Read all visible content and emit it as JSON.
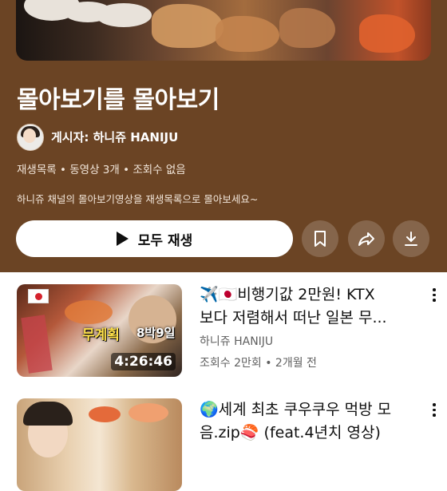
{
  "playlist": {
    "title": "몰아보기를 몰아보기",
    "channel": "게시자: 하니쥬 HANIJU",
    "meta": "재생목록 • 동영상 3개 • 조회수 없음",
    "description": "하니쥬 채널의 몰아보기영상을 재생목록으로 몰아보세요~"
  },
  "actions": {
    "play_all_label": "모두 재생",
    "save_icon": "bookmark-icon",
    "share_icon": "share-icon",
    "download_icon": "download-icon"
  },
  "videos": [
    {
      "title_line1": "✈️🇯🇵비행기값 2만원! KTX",
      "title_line2": "보다 저렴해서 떠난 일본 무...",
      "channel": "하니쥬 HANIJU",
      "stats": "조회수 2만회 • 2개월 전",
      "duration": "4:26:46",
      "overlay_1": "무계획",
      "overlay_2": "8박9일"
    },
    {
      "title_line1": "🌍세계 최초 쿠우쿠우 먹방 모",
      "title_line2": "음.zip🍣 (feat.4년치 영상)"
    }
  ],
  "colors": {
    "header_bg": "#6b4424",
    "text_primary": "#0f0f0f",
    "text_secondary": "#606060"
  }
}
